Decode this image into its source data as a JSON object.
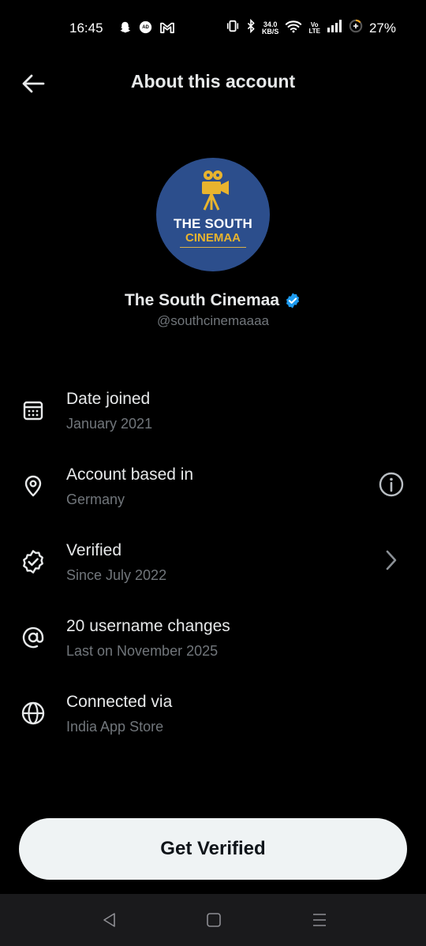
{
  "status_bar": {
    "time": "16:45",
    "left_icons": [
      "snapchat-icon",
      "ad-icon",
      "gmail-icon"
    ],
    "net_speed_value": "34.0",
    "net_speed_unit": "KB/S",
    "volte_top": "Vo",
    "volte_bottom": "LTE",
    "battery_percent": "27%"
  },
  "header": {
    "title": "About this account",
    "back_icon": "arrow-left-icon"
  },
  "profile": {
    "avatar_line1": "THE SOUTH",
    "avatar_line2": "CINEMAA",
    "avatar_bg": "#2c4e8c",
    "name": "The South Cinemaa",
    "handle": "@southcinemaaaa",
    "verified_badge_color": "#1d9bf0"
  },
  "details": [
    {
      "icon": "calendar-icon",
      "title": "Date joined",
      "subtitle": "January 2021",
      "trailing": ""
    },
    {
      "icon": "location-pin-icon",
      "title": "Account based in",
      "subtitle": "Germany",
      "trailing": "info-icon"
    },
    {
      "icon": "verified-icon",
      "title": "Verified",
      "subtitle": "Since July 2022",
      "trailing": "chevron-right-icon"
    },
    {
      "icon": "at-sign-icon",
      "title": "20 username changes",
      "subtitle": "Last on November 2025",
      "trailing": ""
    },
    {
      "icon": "globe-icon",
      "title": "Connected via",
      "subtitle": "India App Store",
      "trailing": ""
    }
  ],
  "cta": {
    "label": "Get Verified"
  },
  "nav_bar": {
    "buttons": [
      "back-triangle-icon",
      "home-square-icon",
      "menu-lines-icon"
    ]
  },
  "colors": {
    "background": "#000000",
    "primary_text": "#e7e9ea",
    "secondary_text": "#71767b",
    "cta_bg": "#eff3f4",
    "cta_text": "#0f1419"
  }
}
